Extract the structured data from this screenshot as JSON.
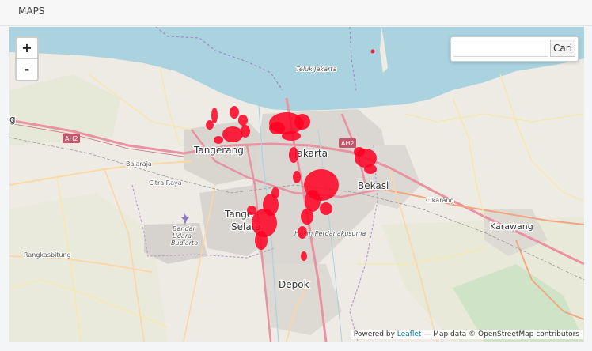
{
  "panel": {
    "title": "MAPS"
  },
  "map": {
    "zoom_in": "+",
    "zoom_out": "-",
    "search": {
      "placeholder": "",
      "value": "",
      "button_label": "Cari"
    },
    "attribution": {
      "prefix": "Powered by",
      "leaflet": "Leaflet",
      "suffix": "— Map data © OpenStreetMap contributors"
    },
    "labels": {
      "bay": "Teluk Jakarta",
      "tangerang": "Tangerang",
      "jakarta": "Jakarta",
      "bekasi": "Bekasi",
      "tangsel_1": "Tange",
      "tangsel_2": "Selata",
      "depok": "Depok",
      "karawang": "Karawang",
      "cikarang": "Cikarang",
      "balaraja": "Balaraja",
      "citra_raya": "Citra Raya",
      "rangkasbitung": "Rangkasbitung",
      "airport_1": "Bandar",
      "airport_2": "Udara",
      "airport_3": "Budiarto",
      "halim": "Halim Perdanakusuma",
      "ah2_west": "AH2",
      "ah2_east": "AH2",
      "edge_g": "g"
    },
    "colors": {
      "sea": "#aad3df",
      "land": "#eeebe4",
      "urban": "#dcd8d3",
      "motorway": "#e892a2",
      "primary": "#fcd6a4",
      "marker": "#ff0022"
    }
  }
}
